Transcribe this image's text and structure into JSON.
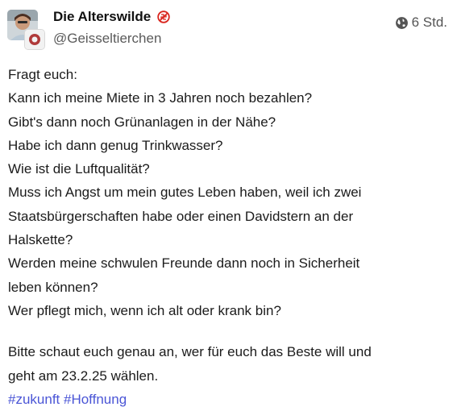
{
  "author": {
    "display_name": "Die Alterswilde",
    "handle": "@Geisseltierchen",
    "name_badge_icon": "no-swastika-icon"
  },
  "meta": {
    "visibility_icon": "globe-icon",
    "timestamp": "6 Std."
  },
  "content": {
    "lines": [
      "Fragt euch:",
      "Kann ich meine Miete in 3 Jahren noch bezahlen?",
      "Gibt's dann noch Grünanlagen in der Nähe?",
      "Habe ich dann genug Trinkwasser?",
      "Wie ist die Luftqualität?",
      "Muss ich Angst um mein gutes Leben haben, weil ich zwei",
      "Staatsbürgerschaften habe oder einen Davidstern an der",
      "Halskette?",
      "Werden meine schwulen Freunde dann noch in Sicherheit",
      "leben können?",
      "Wer pflegt mich, wenn ich alt oder krank bin?"
    ],
    "closing_lines": [
      "Bitte schaut euch genau an, wer für euch das Beste will und",
      "geht am 23.2.25 wählen."
    ],
    "hashtags": [
      "#zukunft",
      "#Hoffnung"
    ]
  },
  "colors": {
    "hashtag": "#4a55d6",
    "badge_red": "#d9241c"
  }
}
